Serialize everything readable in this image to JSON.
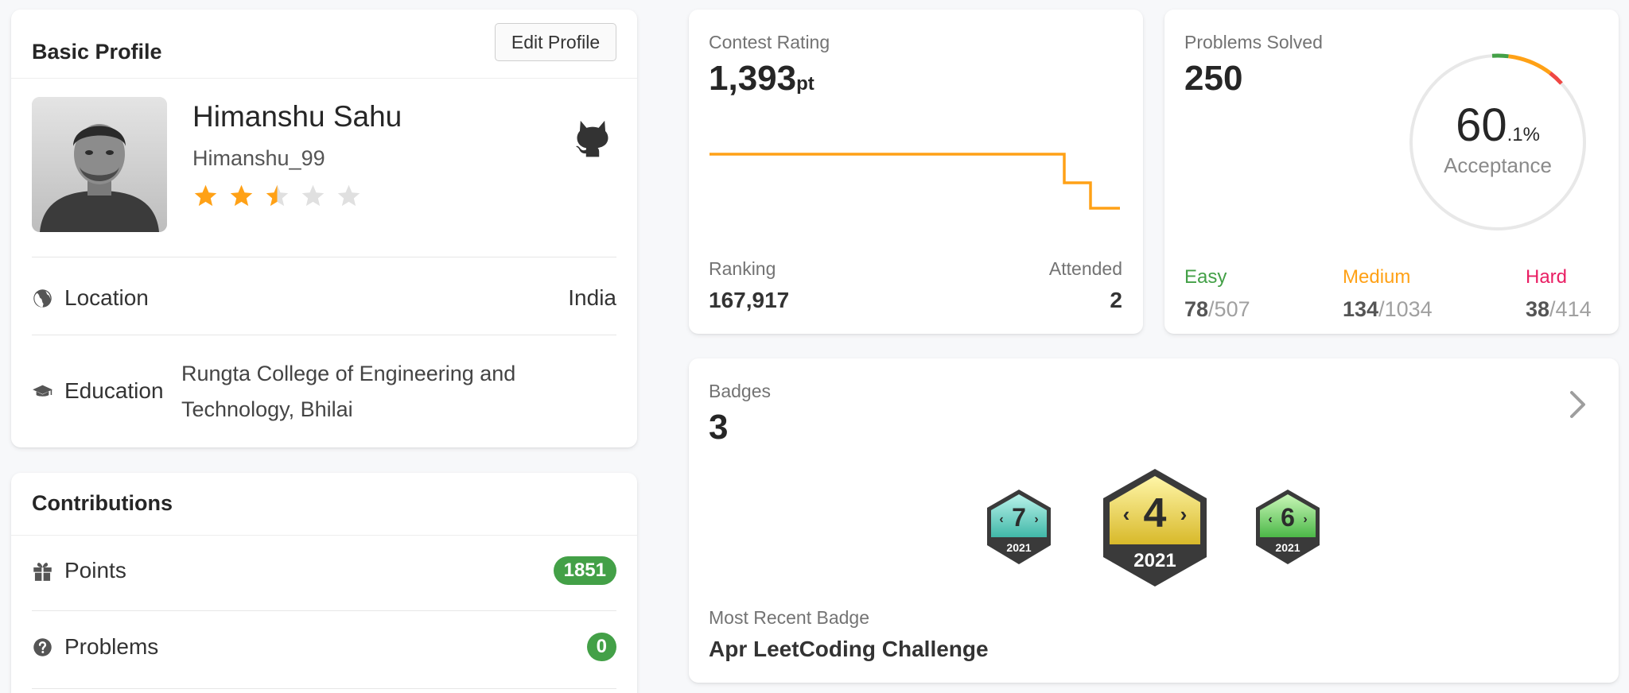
{
  "profile": {
    "title": "Basic Profile",
    "edit_label": "Edit Profile",
    "name": "Himanshu Sahu",
    "username": "Himanshu_99",
    "star_rating": 2.5,
    "star_max": 5,
    "location_label": "Location",
    "location_value": "India",
    "education_label": "Education",
    "education_value": "Rungta College of Engineering and Technology, Bhilai"
  },
  "contributions": {
    "title": "Contributions",
    "points_label": "Points",
    "points_value": "1851",
    "problems_label": "Problems",
    "problems_value": "0"
  },
  "contest": {
    "title": "Contest Rating",
    "rating": "1,393",
    "rating_unit": "pt",
    "ranking_label": "Ranking",
    "ranking_value": "167,917",
    "attended_label": "Attended",
    "attended_value": "2"
  },
  "solved": {
    "title": "Problems Solved",
    "count": "250",
    "acceptance_int": "60",
    "acceptance_dec": ".1%",
    "acceptance_label": "Acceptance",
    "easy_label": "Easy",
    "easy_solved": "78",
    "easy_total": "/507",
    "medium_label": "Medium",
    "medium_solved": "134",
    "medium_total": "/1034",
    "hard_label": "Hard",
    "hard_solved": "38",
    "hard_total": "/414"
  },
  "badges": {
    "title": "Badges",
    "count": "3",
    "items": [
      {
        "number": "7",
        "year": "2021"
      },
      {
        "number": "4",
        "year": "2021"
      },
      {
        "number": "6",
        "year": "2021"
      }
    ],
    "recent_label": "Most Recent Badge",
    "recent_value": "Apr LeetCoding Challenge"
  },
  "colors": {
    "accent_orange": "#ffa116",
    "easy": "#43a047",
    "medium": "#ffa116",
    "hard": "#ef4743",
    "points_badge": "#43a047"
  }
}
